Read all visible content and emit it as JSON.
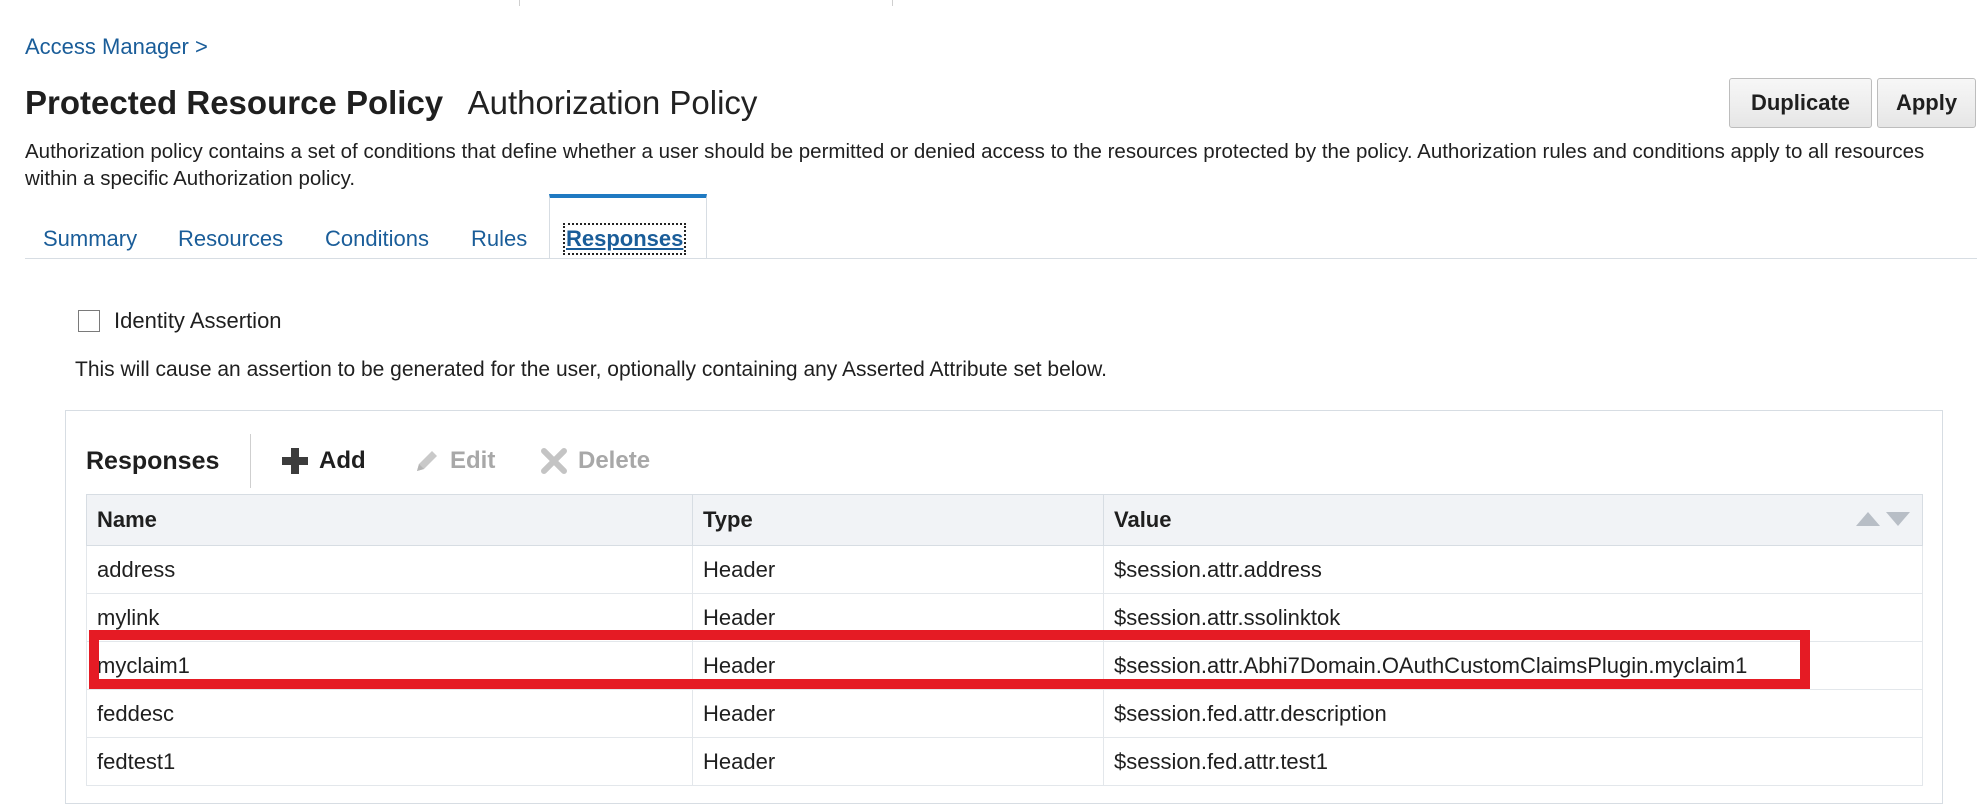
{
  "breadcrumb": "Access Manager >",
  "header": {
    "title": "Protected Resource Policy",
    "subtitle": "Authorization Policy"
  },
  "actions": {
    "duplicate": "Duplicate",
    "apply": "Apply"
  },
  "description": "Authorization policy contains a set of conditions that define whether a user should be permitted or denied access to the resources protected by the policy. Authorization rules and conditions apply to all resources within a specific Authorization policy.",
  "tabs": [
    {
      "label": "Summary"
    },
    {
      "label": "Resources"
    },
    {
      "label": "Conditions"
    },
    {
      "label": "Rules"
    },
    {
      "label": "Responses",
      "active": true
    }
  ],
  "identity_assertion": {
    "label": "Identity Assertion",
    "checked": false
  },
  "assertion_note": "This will cause an assertion to be generated for the user, optionally containing any Asserted Attribute set below.",
  "responses": {
    "title": "Responses",
    "toolbar": {
      "add": "Add",
      "edit": "Edit",
      "delete": "Delete"
    },
    "columns": [
      "Name",
      "Type",
      "Value"
    ],
    "rows": [
      {
        "name": "address",
        "type": "Header",
        "value": "$session.attr.address"
      },
      {
        "name": "mylink",
        "type": "Header",
        "value": "$session.attr.ssolinktok"
      },
      {
        "name": "myclaim1",
        "type": "Header",
        "value": "$session.attr.Abhi7Domain.OAuthCustomClaimsPlugin.myclaim1"
      },
      {
        "name": "feddesc",
        "type": "Header",
        "value": "$session.fed.attr.description"
      },
      {
        "name": "fedtest1",
        "type": "Header",
        "value": "$session.fed.attr.test1"
      }
    ]
  },
  "colors": {
    "link": "#1a5d99",
    "active_tab_accent": "#1f7ac2",
    "highlight_box": "#e51b24"
  },
  "icons": {
    "add": "plus-icon",
    "edit": "pencil-icon",
    "delete": "x-icon",
    "sort": "sort-ascending-descending-icon"
  }
}
